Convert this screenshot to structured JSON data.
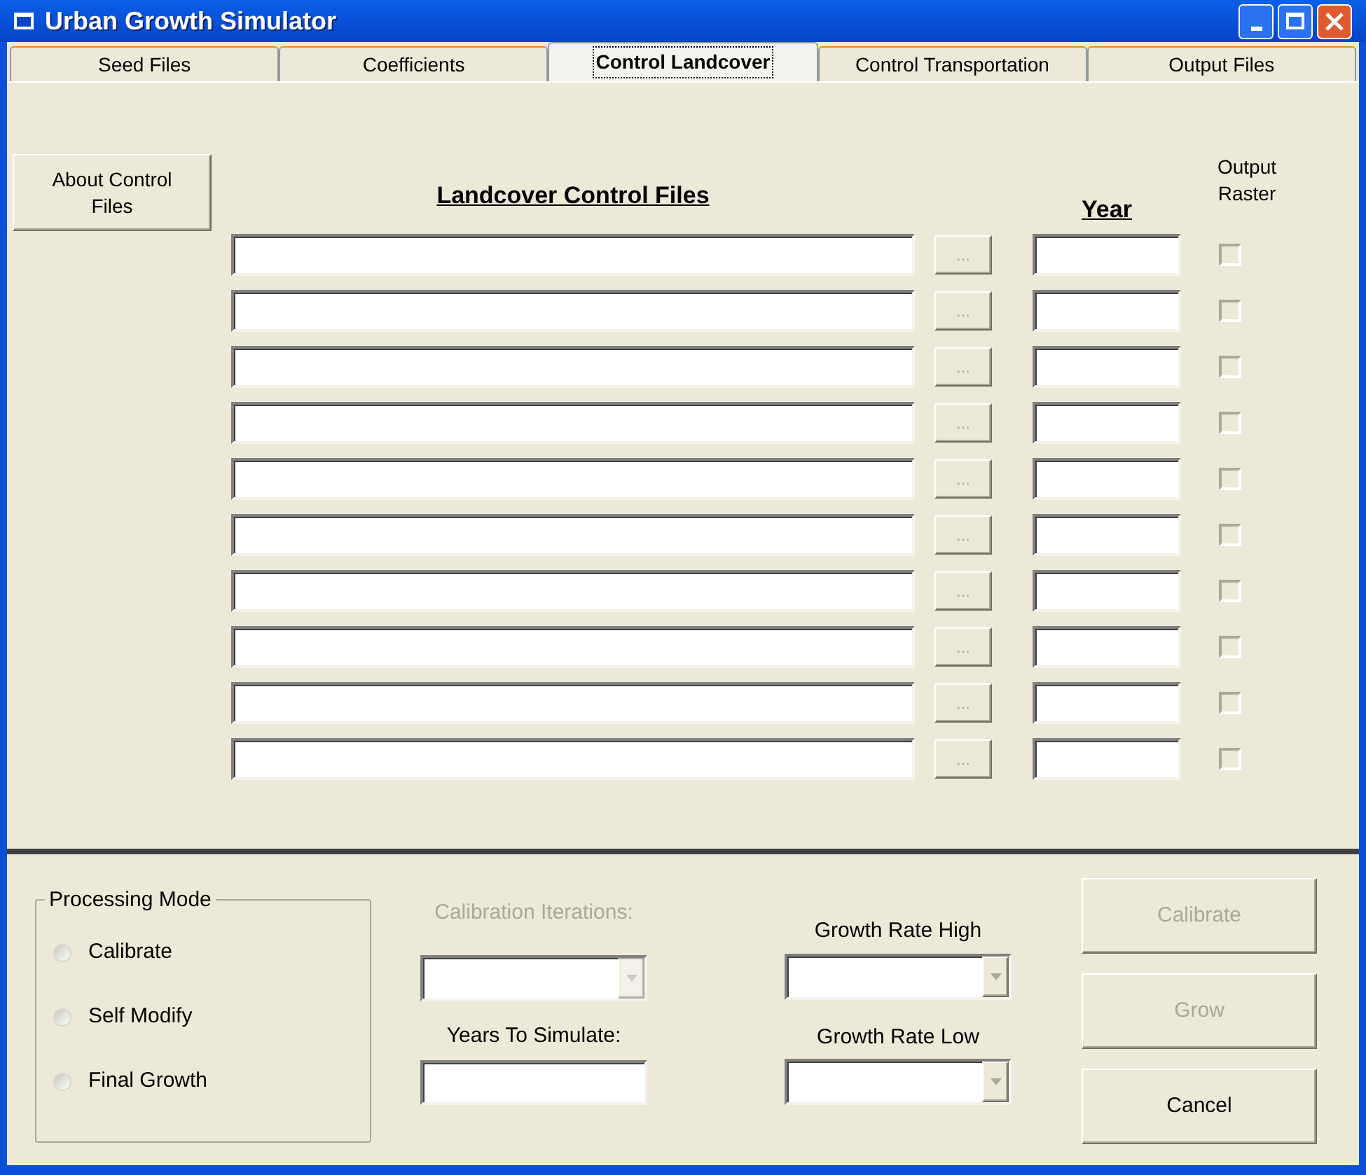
{
  "window": {
    "title": "Urban Growth Simulator"
  },
  "tabs": [
    {
      "label": "Seed Files",
      "selected": false
    },
    {
      "label": "Coefficients",
      "selected": false
    },
    {
      "label": "Control Landcover",
      "selected": true
    },
    {
      "label": "Control Transportation",
      "selected": false
    },
    {
      "label": "Output Files",
      "selected": false
    }
  ],
  "about_button": "About Control Files",
  "columns": {
    "files": "Landcover Control Files",
    "year": "Year",
    "output": "Output Raster"
  },
  "rows": [
    {
      "browse": "...",
      "checked": false,
      "disabled": true
    },
    {
      "browse": "...",
      "checked": false,
      "disabled": true
    },
    {
      "browse": "...",
      "checked": false,
      "disabled": true
    },
    {
      "browse": "...",
      "checked": false,
      "disabled": true
    },
    {
      "browse": "...",
      "checked": false,
      "disabled": true
    },
    {
      "browse": "...",
      "checked": false,
      "disabled": true
    },
    {
      "browse": "...",
      "checked": false,
      "disabled": true
    },
    {
      "browse": "...",
      "checked": false,
      "disabled": true
    },
    {
      "browse": "...",
      "checked": false,
      "disabled": true
    },
    {
      "browse": "...",
      "checked": false,
      "disabled": true
    }
  ],
  "processing_mode": {
    "title": "Processing Mode",
    "options": [
      {
        "label": "Calibrate",
        "selected": false
      },
      {
        "label": "Self Modify",
        "selected": false
      },
      {
        "label": "Final Growth",
        "selected": false
      }
    ]
  },
  "calibration_iterations": {
    "label": "Calibration Iterations:",
    "disabled": true
  },
  "years_to_simulate": {
    "label": "Years To Simulate:"
  },
  "growth_rate_high": {
    "label": "Growth Rate High"
  },
  "growth_rate_low": {
    "label": "Growth Rate Low"
  },
  "buttons": [
    {
      "label": "Calibrate",
      "disabled": true
    },
    {
      "label": "Grow",
      "disabled": true
    },
    {
      "label": "Cancel",
      "disabled": false
    }
  ]
}
